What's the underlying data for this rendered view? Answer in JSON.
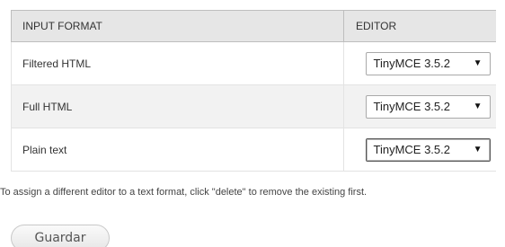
{
  "table": {
    "headers": {
      "input_format": "INPUT FORMAT",
      "editor": "EDITOR"
    },
    "rows": [
      {
        "format": "Filtered HTML",
        "editor": "TinyMCE 3.5.2"
      },
      {
        "format": "Full HTML",
        "editor": "TinyMCE 3.5.2"
      },
      {
        "format": "Plain text",
        "editor": "TinyMCE 3.5.2"
      }
    ],
    "select_arrow": "▼"
  },
  "help_text": "To assign a different editor to a text format, click \"delete\" to remove the existing first.",
  "save_button": {
    "label": "Guardar"
  }
}
